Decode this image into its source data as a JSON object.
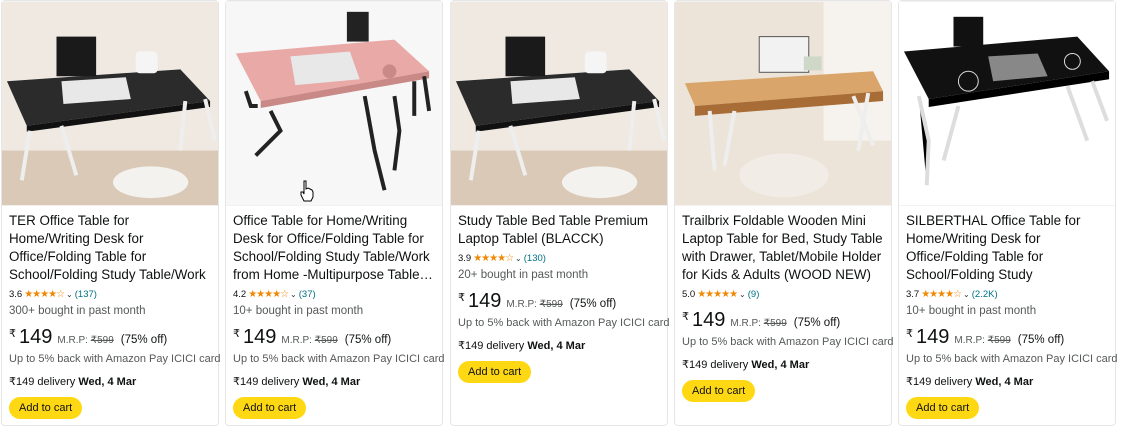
{
  "products": [
    {
      "title": "TER Office Table for Home/Writing Desk for Office/Folding Table for School/Folding Study Table/Work from Home Multipurpose Table…",
      "rating": "3.6",
      "stars": "★★★★☆",
      "reviews": "(137)",
      "bought": "300+ bought in past month",
      "currency": "₹",
      "price": "149",
      "mrp_label": "M.R.P:",
      "mrp": "₹599",
      "discount": "(75% off)",
      "cashback": "Up to 5% back with Amazon Pay ICICI card",
      "delivery_prefix": "₹149 delivery",
      "delivery_date": "Wed, 4 Mar",
      "cta": "Add to cart",
      "image_theme": "black-desk"
    },
    {
      "title": "Office Table for Home/Writing Desk for Office/Folding Table for School/Folding Study Table/Work from Home -Multipurpose Table…",
      "rating": "4.2",
      "stars": "★★★★☆",
      "reviews": "(37)",
      "bought": "10+ bought in past month",
      "currency": "₹",
      "price": "149",
      "mrp_label": "M.R.P:",
      "mrp": "₹599",
      "discount": "(75% off)",
      "cashback": "Up to 5% back with Amazon Pay ICICI card",
      "delivery_prefix": "₹149 delivery",
      "delivery_date": "Wed, 4 Mar",
      "cta": "Add to cart",
      "image_theme": "pink-desk"
    },
    {
      "title": "Study Table Bed Table Premium Laptop Tablel (BLACCK)",
      "rating": "3.9",
      "stars": "★★★★☆",
      "reviews": "(130)",
      "bought": "20+ bought in past month",
      "currency": "₹",
      "price": "149",
      "mrp_label": "M.R.P:",
      "mrp": "₹599",
      "discount": "(75% off)",
      "cashback": "Up to 5% back with Amazon Pay ICICI card",
      "delivery_prefix": "₹149 delivery",
      "delivery_date": "Wed, 4 Mar",
      "cta": "Add to cart",
      "image_theme": "black-desk"
    },
    {
      "title": "Trailbrix Foldable Wooden Mini Laptop Table for Bed, Study Table with Drawer, Tablet/Mobile Holder for Kids & Adults (WOOD NEW)",
      "rating": "5.0",
      "stars": "★★★★★",
      "reviews": "(9)",
      "bought": "",
      "currency": "₹",
      "price": "149",
      "mrp_label": "M.R.P:",
      "mrp": "₹599",
      "discount": "(75% off)",
      "cashback": "Up to 5% back with Amazon Pay ICICI card",
      "delivery_prefix": "₹149 delivery",
      "delivery_date": "Wed, 4 Mar",
      "cta": "Add to cart",
      "image_theme": "wood-desk"
    },
    {
      "title": "SILBERTHAL Office Table for Home/Writing Desk for Office/Folding Table for School/Folding Study Table/Work…",
      "rating": "3.7",
      "stars": "★★★★☆",
      "reviews": "(2.2K)",
      "bought": "10+ bought in past month",
      "currency": "₹",
      "price": "149",
      "mrp_label": "M.R.P:",
      "mrp": "₹599",
      "discount": "(75% off)",
      "cashback": "Up to 5% back with Amazon Pay ICICI card",
      "delivery_prefix": "₹149 delivery",
      "delivery_date": "Wed, 4 Mar",
      "cta": "Add to cart",
      "image_theme": "floral-desk"
    }
  ],
  "colors": {
    "cta_bg": "#ffd814",
    "star": "#f08804",
    "link": "#007185",
    "muted": "#565959"
  },
  "icons": {
    "pointer": "hand-pointer-icon",
    "chevron": "chevron-down-icon"
  }
}
